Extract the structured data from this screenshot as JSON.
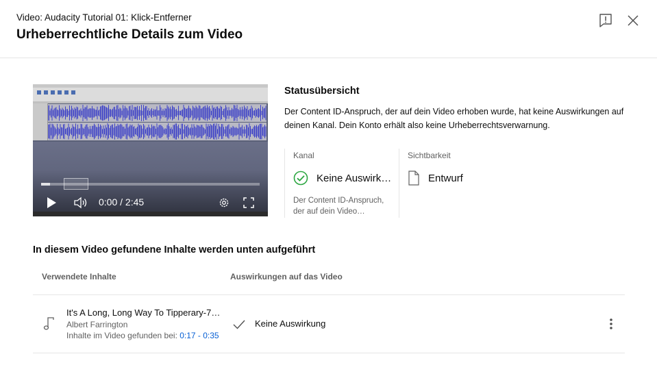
{
  "header": {
    "subtitle": "Video: Audacity Tutorial 01: Klick-Entferner",
    "title": "Urheberrechtliche Details zum Video",
    "icons": {
      "feedback": "feedback-exclamation-icon",
      "close": "close-icon"
    }
  },
  "player": {
    "time": "0:00 / 2:45",
    "progress_loaded": 0.04,
    "icons": {
      "play": "play-icon",
      "volume": "volume-icon",
      "settings": "gear-icon",
      "fullscreen": "fullscreen-icon"
    }
  },
  "status": {
    "title": "Statusübersicht",
    "description": "Der Content ID-Anspruch, der auf dein Video erhoben wurde, hat keine Auswirkungen auf deinen Kanal. Dein Konto erhält also keine Urheberrechtsverwarnung.",
    "channel": {
      "label": "Kanal",
      "value": "Keine Auswirkungen",
      "note": "Der Content ID-Anspruch, der auf dein Video…",
      "icon": "check-circle-icon",
      "color": "#2ba640"
    },
    "visibility": {
      "label": "Sichtbarkeit",
      "value": "Entwurf",
      "icon": "document-icon"
    }
  },
  "content": {
    "section_title": "In diesem Video gefundene Inhalte werden unten aufgeführt",
    "col_used": "Verwendete Inhalte",
    "col_impact": "Auswirkungen auf das Video",
    "rows": [
      {
        "title": "It's A Long, Long Way To Tipperary-72…",
        "artist": "Albert Farrington",
        "found_label": "Inhalte im Video gefunden bei: ",
        "found_range": "0:17 - 0:35",
        "impact": "Keine Auswirkung",
        "icon": "music-note-icon",
        "impact_icon": "check-icon",
        "menu_icon": "more-vert-icon"
      }
    ]
  },
  "colors": {
    "link": "#065fd4",
    "secondary_text": "#606060",
    "divider": "#e5e5e5"
  }
}
